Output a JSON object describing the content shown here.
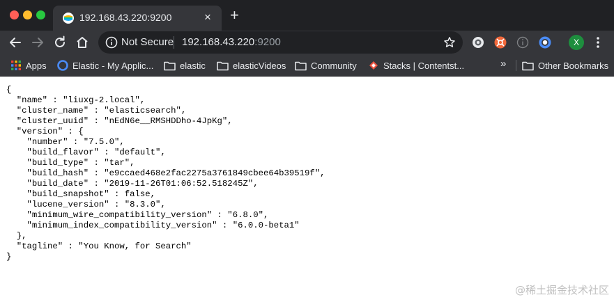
{
  "window": {
    "tab": {
      "title": "192.168.43.220:9200",
      "close_glyph": "×"
    },
    "new_tab_glyph": "+"
  },
  "toolbar": {
    "security_label": "Not Secure",
    "url_host": "192.168.43.220",
    "url_port": ":9200",
    "profile_initial": "X"
  },
  "bookmarks": {
    "items": [
      {
        "label": "Apps",
        "icon": "apps-grid-icon"
      },
      {
        "label": "Elastic - My Applic...",
        "icon": "elastic-icon"
      },
      {
        "label": "elastic",
        "icon": "folder-icon"
      },
      {
        "label": "elasticVideos",
        "icon": "folder-icon"
      },
      {
        "label": "Community",
        "icon": "folder-icon"
      },
      {
        "label": "Stacks | Contentst...",
        "icon": "contentstack-icon"
      }
    ],
    "overflow_glyph": "»",
    "other_bookmarks": "Other Bookmarks"
  },
  "page": {
    "json_lines": [
      "{",
      "  \"name\" : \"liuxg-2.local\",",
      "  \"cluster_name\" : \"elasticsearch\",",
      "  \"cluster_uuid\" : \"nEdN6e__RMSHDDho-4JpKg\",",
      "  \"version\" : {",
      "    \"number\" : \"7.5.0\",",
      "    \"build_flavor\" : \"default\",",
      "    \"build_type\" : \"tar\",",
      "    \"build_hash\" : \"e9ccaed468e2fac2275a3761849cbee64b39519f\",",
      "    \"build_date\" : \"2019-11-26T01:06:52.518245Z\",",
      "    \"build_snapshot\" : false,",
      "    \"lucene_version\" : \"8.3.0\",",
      "    \"minimum_wire_compatibility_version\" : \"6.8.0\",",
      "    \"minimum_index_compatibility_version\" : \"6.0.0-beta1\"",
      "  },",
      "  \"tagline\" : \"You Know, for Search\"",
      "}"
    ],
    "watermark": "@稀土掘金技术社区"
  },
  "colors": {
    "tabstrip_bg": "#202124",
    "toolbar_bg": "#35363a",
    "text_light": "#e8eaed",
    "url_port": "#9aa0a6",
    "profile_avatar": "#1e8e3e"
  }
}
